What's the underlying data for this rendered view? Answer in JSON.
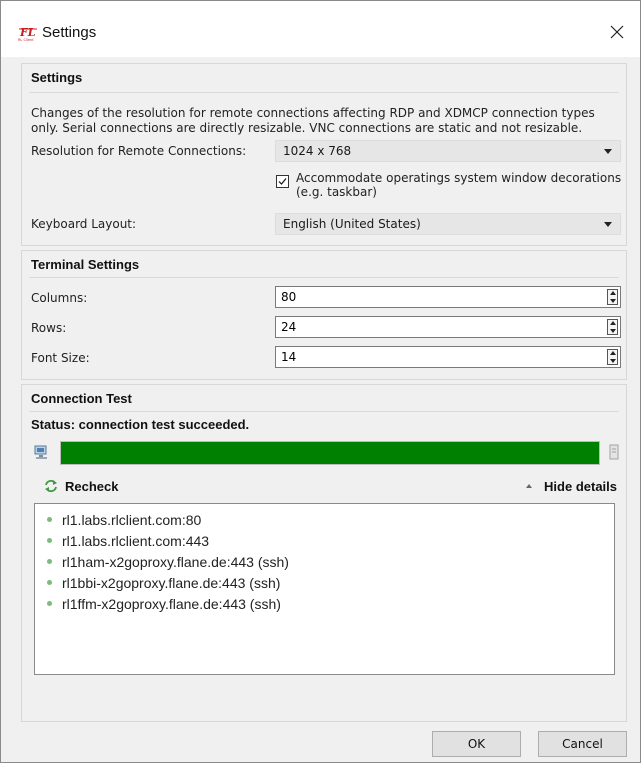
{
  "window": {
    "title": "Settings",
    "app_icon_text": "FL",
    "app_icon_subtext": "RL Client"
  },
  "settings": {
    "title": "Settings",
    "description": "Changes of the resolution for remote connections affecting RDP and XDMCP connection types only. Serial connections are directly resizable. VNC connections are static and not resizable.",
    "resolution_label": "Resolution for Remote Connections:",
    "resolution_value": "1024 x 768",
    "accommodate_label": "Accommodate operatings system window decorations (e.g. taskbar)",
    "accommodate_checked": true,
    "keyboard_label": "Keyboard Layout:",
    "keyboard_value": "English (United States)"
  },
  "terminal": {
    "title": "Terminal Settings",
    "columns_label": "Columns:",
    "columns_value": "80",
    "rows_label": "Rows:",
    "rows_value": "24",
    "font_size_label": "Font Size:",
    "font_size_value": "14"
  },
  "connection_test": {
    "title": "Connection Test",
    "status": "Status:  connection test succeeded.",
    "progress_fraction": 1.0,
    "recheck_label": "Recheck",
    "hide_details_label": "Hide details",
    "entries": [
      "rl1.labs.rlclient.com:80",
      "rl1.labs.rlclient.com:443",
      "rl1ham-x2goproxy.flane.de:443 (ssh)",
      "rl1bbi-x2goproxy.flane.de:443 (ssh)",
      "rl1ffm-x2goproxy.flane.de:443 (ssh)"
    ]
  },
  "buttons": {
    "ok": "OK",
    "cancel": "Cancel"
  },
  "colors": {
    "progress_fill": "#008000",
    "success_dot": "#7dbb7d",
    "recheck_icon": "#3f9a3f",
    "icon_red": "#c81e1e"
  },
  "icons": {
    "app": "rlclient-logo-icon",
    "close": "close-icon",
    "dropdown": "chevron-down-icon",
    "checkbox": "checkmark-icon",
    "local_computer": "computer-icon",
    "server": "server-icon",
    "recheck": "refresh-icon",
    "hide_details": "triangle-up-icon",
    "status_entry": "dot-icon"
  }
}
